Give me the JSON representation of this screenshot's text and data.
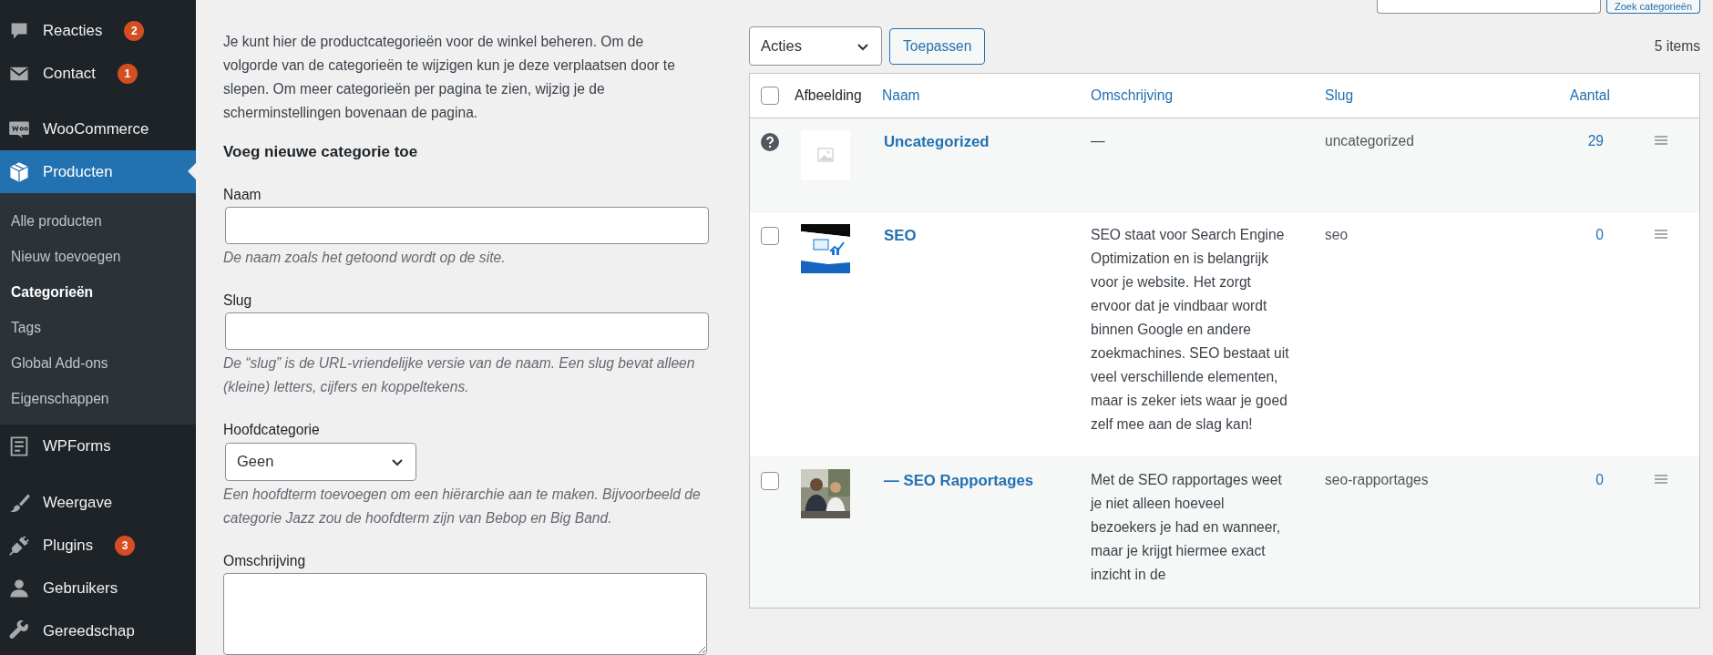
{
  "sidebar": {
    "items": [
      {
        "label": "Reacties",
        "badge": "2",
        "selected": false
      },
      {
        "label": "Contact",
        "badge": "1",
        "selected": false
      },
      {
        "label": "WooCommerce",
        "selected": false
      },
      {
        "label": "Producten",
        "selected": true,
        "children": [
          {
            "label": "Alle producten",
            "selected": false
          },
          {
            "label": "Nieuw toevoegen",
            "selected": false
          },
          {
            "label": "Categorieën",
            "selected": true
          },
          {
            "label": "Tags",
            "selected": false
          },
          {
            "label": "Global Add-ons",
            "selected": false
          },
          {
            "label": "Eigenschappen",
            "selected": false
          }
        ]
      },
      {
        "label": "WPForms",
        "selected": false
      },
      {
        "label": "Weergave",
        "selected": false
      },
      {
        "label": "Plugins",
        "badge": "3",
        "selected": false
      },
      {
        "label": "Gebruikers",
        "selected": false
      },
      {
        "label": "Gereedschap",
        "selected": false
      }
    ]
  },
  "search": {
    "button": "Zoek categorieën"
  },
  "form": {
    "intro": "Je kunt hier de productcategorieën voor de winkel beheren. Om de volgorde van de categorieën te wijzigen kun je deze verplaatsen door te slepen. Om meer categorieën per pagina te zien, wijzig je de scherminstellingen bovenaan de pagina.",
    "heading": "Voeg nieuwe categorie toe",
    "fields": [
      {
        "kind": "text",
        "label": "Naam",
        "hint": "De naam zoals het getoond wordt op de site."
      },
      {
        "kind": "text",
        "label": "Slug",
        "hint": "De “slug” is de URL-vriendelijke versie van de naam. Een slug bevat alleen (kleine) letters, cijfers en koppeltekens."
      },
      {
        "kind": "select",
        "label": "Hoofdcategorie",
        "value": "Geen",
        "hint": "Een hoofdterm toevoegen om een hiërarchie aan te maken. Bijvoorbeeld de categorie Jazz zou de hoofdterm zijn van Bebop en Big Band."
      },
      {
        "kind": "textarea",
        "label": "Omschrijving"
      }
    ]
  },
  "table": {
    "select_all_checked": false,
    "bulk_action": "Acties",
    "apply": "Toepassen",
    "count": "5 items",
    "columns": [
      {
        "label": "Afbeelding",
        "sortable": false
      },
      {
        "label": "Naam",
        "sortable": true
      },
      {
        "label": "Omschrijving",
        "sortable": true
      },
      {
        "label": "Slug",
        "sortable": true
      },
      {
        "label": "Aantal",
        "sortable": true
      }
    ],
    "rows": [
      {
        "kind": "default",
        "name": "Uncategorized",
        "description": "—",
        "slug": "uncategorized",
        "count": "29"
      },
      {
        "kind": "checkbox",
        "checked": false,
        "name": "SEO",
        "description": "SEO staat voor Search Engine Optimization en is belangrijk voor je website. Het zorgt ervoor dat je vindbaar wordt binnen Google en andere zoekmachines. SEO bestaat uit veel verschillende elementen, maar is zeker iets waar je goed zelf mee aan de slag kan!",
        "slug": "seo",
        "count": "0"
      },
      {
        "kind": "checkbox",
        "checked": false,
        "name": "— SEO Rapportages",
        "description": "Met de SEO rapportages weet je niet alleen hoeveel bezoekers je had en wanneer, maar je krijgt hiermee exact inzicht in de",
        "slug": "seo-rapportages",
        "count": "0"
      }
    ]
  }
}
